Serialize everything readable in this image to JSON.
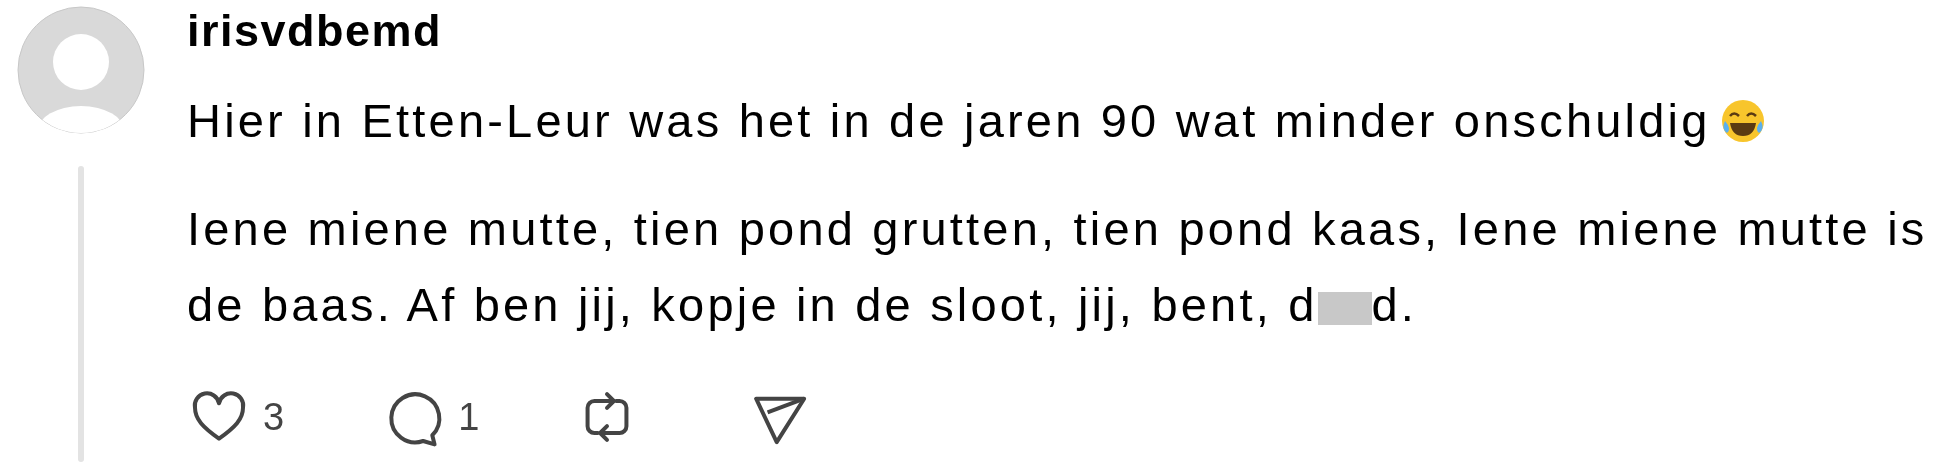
{
  "post": {
    "username": "irisvdbemd",
    "lines": [
      {
        "text": "Hier in Etten-Leur was het in de jaren 90 wat minder onschuldig",
        "emoji": true
      }
    ],
    "paragraph": [
      {
        "kind": "text",
        "text": "Iene miene mutte, tien pond grutten, tien pond kaas, Iene miene mutte is de baas. Af ben jij, kopje in de sloot, jij, bent, d"
      },
      {
        "kind": "redaction"
      },
      {
        "kind": "text",
        "text": "d."
      }
    ],
    "actions": [
      {
        "kind": "like",
        "count": "3"
      },
      {
        "kind": "reply",
        "count": "1"
      },
      {
        "kind": "repost"
      },
      {
        "kind": "share"
      }
    ]
  }
}
